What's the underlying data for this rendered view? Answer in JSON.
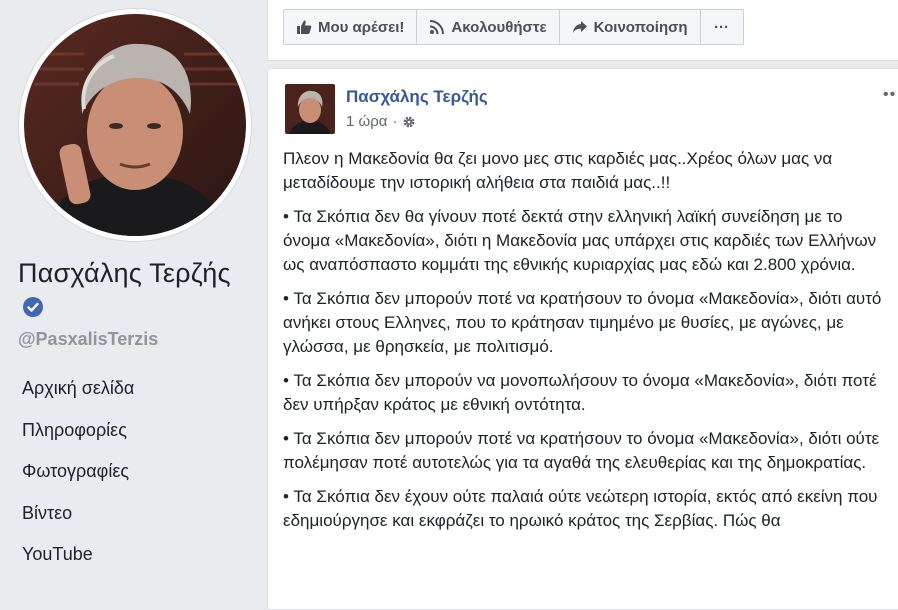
{
  "sidebar": {
    "page_name": "Πασχάλης Τερζής",
    "handle": "@PasxalisTerzis",
    "nav_items": [
      "Αρχική σελίδα",
      "Πληροφορίες",
      "Φωτογραφίες",
      "Βίντεο",
      "YouTube"
    ]
  },
  "actions": {
    "like": "Μου αρέσει!",
    "follow": "Ακολουθήστε",
    "share": "Κοινοποίηση",
    "more": "···"
  },
  "post": {
    "author": "Πασχάλης Τερζής",
    "time": "1 ώρα",
    "separator": "·",
    "options": "••",
    "paragraphs": [
      "Πλεον η Μακεδονία θα ζει μονο μες στις καρδιές μας..Χρέος όλων μας να μεταδίδουμε την ιστορική αλήθεια στα παιδιά μας..!!",
      "• Τα Σκόπια δεν θα γίνουν ποτέ δεκτά στην ελληνική λαϊκή συνείδηση με το όνομα «Μακεδονία», διότι η Μακεδονία μας υπάρχει στις καρδιές των Ελλήνων ως αναπόσπαστο κομμάτι της εθνικής κυριαρχίας μας εδώ και 2.800 χρόνια.",
      "• Τα Σκόπια δεν μπορούν ποτέ να κρατήσουν το όνομα «Μακεδονία», διότι αυτό ανήκει στους Ελληνες, που το κράτησαν τιμημένο με θυσίες, με αγώνες, με γλώσσα, με θρησκεία, με πολιτισμό.",
      "• Τα Σκόπια δεν μπορούν να μονοπωλήσουν το όνομα «Μακεδονία», διότι ποτέ δεν υπήρξαν κράτος με εθνική οντότητα.",
      "• Τα Σκόπια δεν μπορούν ποτέ να κρατήσουν το όνομα «Μακεδονία», διότι ούτε πολέμησαν ποτέ αυτοτελώς για τα αγαθά της ελευθερίας και της δημοκρατίας.",
      "• Τα Σκόπια δεν έχουν ούτε παλαιά ούτε νεώτερη ιστορία, εκτός από εκείνη που εδημιούργησε και εκφράζει το ηρωικό κράτος της Σερβίας. Πώς θα"
    ]
  },
  "colors": {
    "background": "#e9ebee",
    "link": "#365899",
    "verified": "#4267b2",
    "muted": "#90949c"
  }
}
